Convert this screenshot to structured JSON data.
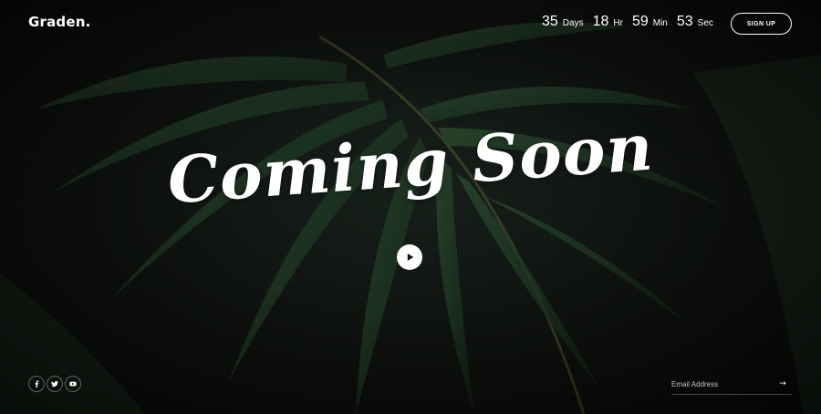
{
  "brand": {
    "logo": "Graden."
  },
  "countdown": [
    {
      "value": "35",
      "unit": "Days"
    },
    {
      "value": "18",
      "unit": "Hr"
    },
    {
      "value": "59",
      "unit": "Min"
    },
    {
      "value": "53",
      "unit": "Sec"
    }
  ],
  "header": {
    "signup_label": "SIGN UP"
  },
  "hero": {
    "title": "Coming Soon",
    "play_icon": "play-icon"
  },
  "social": [
    {
      "name": "facebook-icon",
      "glyph": "f"
    },
    {
      "name": "twitter-icon",
      "glyph": "t"
    },
    {
      "name": "youtube-icon",
      "glyph": "y"
    }
  ],
  "newsletter": {
    "placeholder": "Email Address",
    "submit_label": "→"
  },
  "colors": {
    "background": "#0d0c0b",
    "foreground": "#ffffff",
    "leaf": "#1f3a23"
  }
}
